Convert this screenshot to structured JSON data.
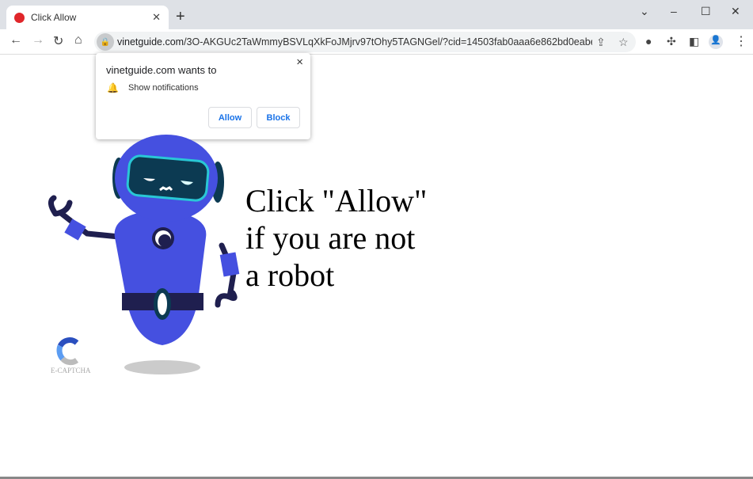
{
  "browser": {
    "tab_title": "Click Allow",
    "url_domain": "vinetguide.com",
    "url_rest": "/3O-AKGUc2TaWmmyBSVLqXkFoJMjrv97tOhy5TAGNGel/?cid=14503fab0aaa6e862bd0eabe8933..."
  },
  "popup": {
    "title": "vinetguide.com wants to",
    "permission": "Show notifications",
    "allow_label": "Allow",
    "block_label": "Block"
  },
  "page": {
    "headline_lines": [
      "Click \"Allow\"",
      "if you are not",
      "a robot"
    ],
    "logo_text": "E-CAPTCHA"
  },
  "colors": {
    "robot_blue": "#4550e0",
    "robot_dark": "#1f1f4f",
    "visor": "#0c3a52",
    "accent": "#1a73e8"
  }
}
